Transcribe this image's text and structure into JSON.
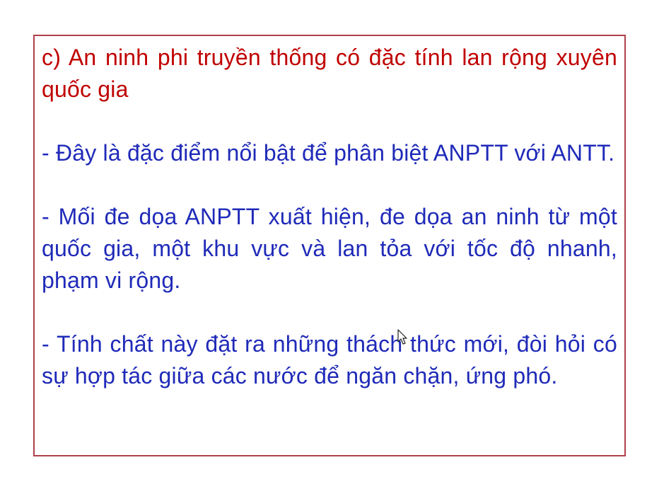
{
  "slide": {
    "heading": "c) An ninh phi truyền thống có đặc tính lan rộng xuyên quốc gia",
    "paragraphs": [
      "- Đây là đặc điểm nổi bật để phân biệt ANPTT với ANTT.",
      "- Mối đe dọa ANPTT xuất hiện, đe dọa an ninh từ một quốc gia, một khu vực và lan tỏa với tốc độ nhanh, phạm vi rộng.",
      "- Tính chất này đặt ra những thách thức mới, đòi hỏi có sự hợp tác giữa các nước để ngăn chặn, ứng phó."
    ]
  },
  "colors": {
    "heading": "#c00000",
    "body": "#1f2ab8",
    "border": "#b0404a"
  },
  "icons": {
    "cursor": "mouse-pointer-icon"
  }
}
